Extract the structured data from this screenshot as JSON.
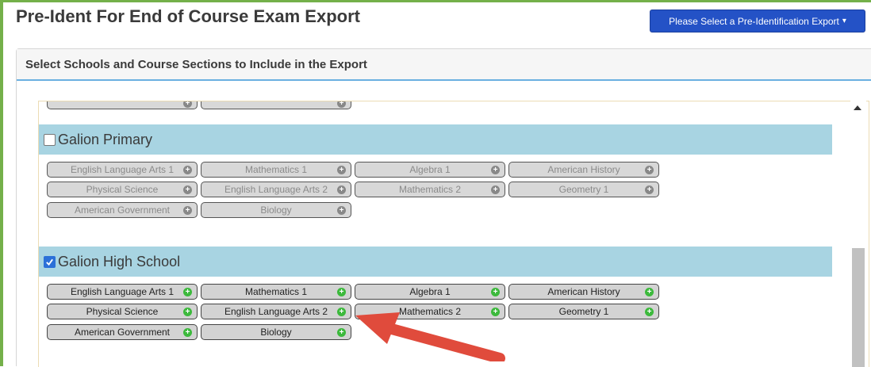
{
  "page": {
    "title": "Pre-Ident For End of Course Exam Export",
    "export_button": {
      "label": "Please Select a Pre-Identification Export",
      "caret": "▾"
    }
  },
  "panel": {
    "header": "Select Schools and Course Sections to Include in the Export"
  },
  "schools": [
    {
      "name": "Galion Primary",
      "checked": false,
      "rows": [
        [
          "English Language Arts 1",
          "Mathematics 1",
          "Algebra 1",
          "American History"
        ],
        [
          "Physical Science",
          "English Language Arts 2",
          "Mathematics 2",
          "Geometry 1"
        ],
        [
          "American Government",
          "Biology"
        ]
      ]
    },
    {
      "name": "Galion High School",
      "checked": true,
      "rows": [
        [
          "English Language Arts 1",
          "Mathematics 1",
          "Algebra 1",
          "American History"
        ],
        [
          "Physical Science",
          "English Language Arts 2",
          "Mathematics 2",
          "Geometry 1"
        ],
        [
          "American Government",
          "Biology"
        ]
      ]
    }
  ],
  "colors": {
    "accent": "#2452c6",
    "school_header_bg": "#a8d4e2",
    "add_icon": "#3cb93c",
    "arrow": "#e04b3c"
  },
  "icons": {
    "add": "plus-circle-icon",
    "scroll_up": "scroll-up-arrow-icon"
  }
}
